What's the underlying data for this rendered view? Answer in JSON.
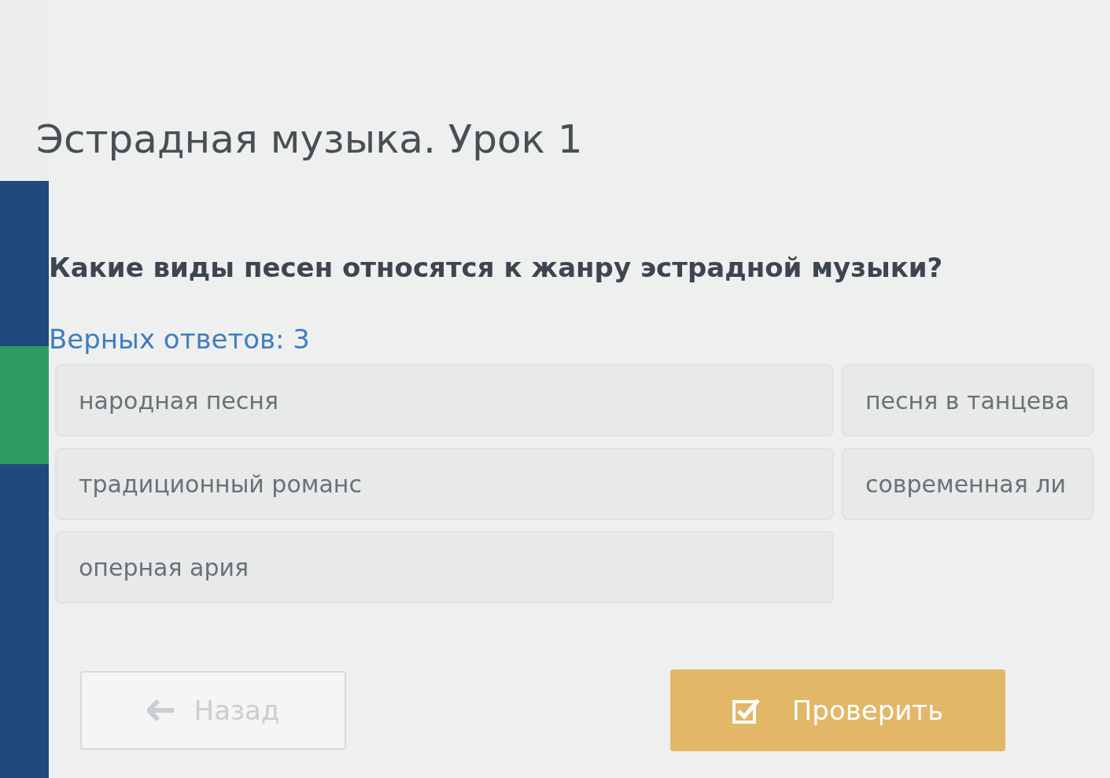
{
  "title": "Эстрадная музыка. Урок 1",
  "question": "Какие виды песен относятся к жанру эстрадной музыки?",
  "answers_hint": "Верных ответов: 3",
  "options": [
    {
      "label": "народная песня",
      "selected": false
    },
    {
      "label": "песня в танцева",
      "selected": false
    },
    {
      "label": "традиционный романс",
      "selected": false
    },
    {
      "label": "современная ли",
      "selected": false
    },
    {
      "label": "оперная ария",
      "selected": false
    }
  ],
  "buttons": [
    {
      "kind": "back",
      "label": "Назад",
      "disabled": true
    },
    {
      "kind": "check",
      "label": "Проверить",
      "disabled": true
    }
  ]
}
